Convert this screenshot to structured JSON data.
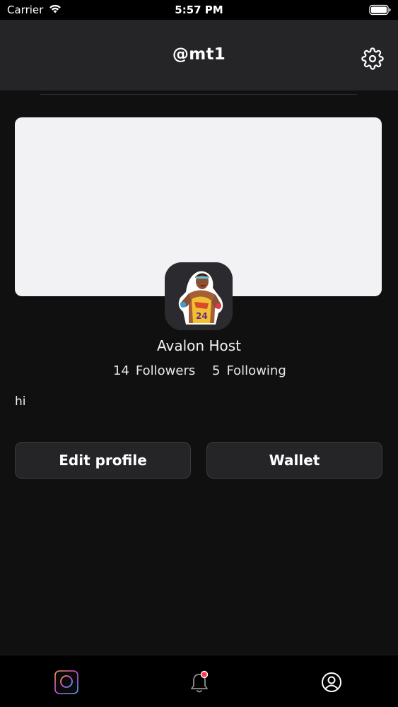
{
  "status_bar": {
    "carrier": "Carrier",
    "time": "5:57 PM",
    "wifi_icon": "wifi-icon",
    "battery_icon": "battery-icon"
  },
  "header": {
    "title": "@mt1",
    "settings_icon": "gear-icon"
  },
  "profile": {
    "display_name": "Avalon Host",
    "followers_count": "14",
    "followers_label": "Followers",
    "following_count": "5",
    "following_label": "Following",
    "bio": "hi"
  },
  "actions": {
    "edit_profile_label": "Edit profile",
    "wallet_label": "Wallet"
  },
  "tab_bar": {
    "tabs": [
      {
        "name": "home",
        "icon": "app-logo-icon"
      },
      {
        "name": "notifications",
        "icon": "bell-icon",
        "has_badge": true
      },
      {
        "name": "profile",
        "icon": "user-circle-icon"
      }
    ]
  },
  "colors": {
    "background": "#101011",
    "header": "#252528",
    "banner": "#f2f2f4",
    "button": "#252528",
    "notification_badge": "#ff3b47"
  }
}
